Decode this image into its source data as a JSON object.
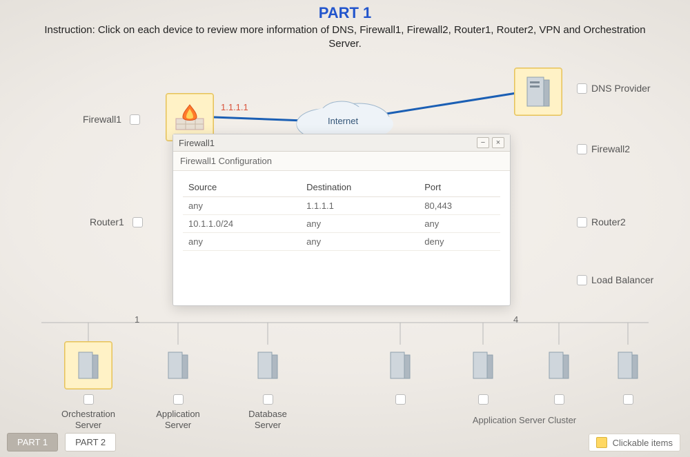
{
  "header": {
    "title": "PART 1",
    "instruction": "Instruction: Click on each device to review more information of DNS, Firewall1, Firewall2, Router1, Router2, VPN and Orchestration Server."
  },
  "labels": {
    "firewall1": "Firewall1",
    "firewall2": "Firewall2",
    "router1": "Router1",
    "router2": "Router2",
    "dns_provider": "DNS Provider",
    "load_balancer": "Load Balancer",
    "internet": "Internet",
    "fw1_ip": "1.1.1.1",
    "left_frag": "1",
    "right_frag": "4"
  },
  "bottom_row": {
    "orchestration": "Orchestration Server",
    "app_server": "Application Server",
    "db_server": "Database Server",
    "app_cluster": "Application Server Cluster"
  },
  "popup": {
    "title": "Firewall1",
    "subtitle": "Firewall1 Configuration",
    "columns": {
      "c0": "Source",
      "c1": "Destination",
      "c2": "Port"
    },
    "rows": [
      {
        "c0": "any",
        "c1": "1.1.1.1",
        "c2": "80,443"
      },
      {
        "c0": "10.1.1.0/24",
        "c1": "any",
        "c2": "any"
      },
      {
        "c0": "any",
        "c1": "any",
        "c2": "deny"
      }
    ],
    "minimize_glyph": "−",
    "close_glyph": "×"
  },
  "tabs": {
    "part1": "PART 1",
    "part2": "PART 2"
  },
  "legend": {
    "label": "Clickable items"
  }
}
